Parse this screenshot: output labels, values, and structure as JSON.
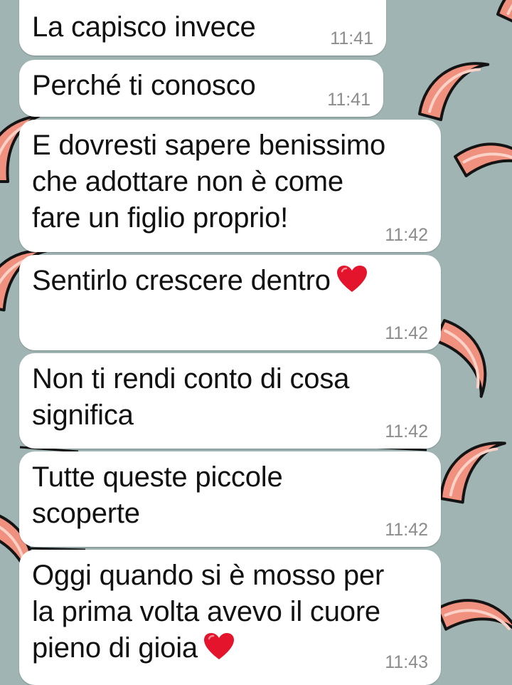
{
  "colors": {
    "wallpaper": "#9fb4b3",
    "bubble": "#ffffff",
    "text": "#111111",
    "timestamp": "#8c8c8c",
    "heart": "#e3142c",
    "shrimp": "#f0907e"
  },
  "messages": [
    {
      "text": "La capisco invece",
      "time": "11:41",
      "emoji": ""
    },
    {
      "text": "Perché ti conosco",
      "time": "11:41",
      "emoji": ""
    },
    {
      "text": "E dovresti sapere benissimo\nche adottare non è come\nfare un figlio proprio!",
      "time": "11:42",
      "emoji": ""
    },
    {
      "text": "Sentirlo crescere dentro",
      "time": "11:42",
      "emoji": "heart"
    },
    {
      "text": "Non ti rendi conto di cosa\nsignifica",
      "time": "11:42",
      "emoji": ""
    },
    {
      "text": "Tutte queste piccole\nscoperte",
      "time": "11:42",
      "emoji": ""
    },
    {
      "text": "Oggi quando si è mosso per\nla prima volta avevo il cuore\npieno di gioia",
      "time": "11:43",
      "emoji": "heart"
    }
  ]
}
